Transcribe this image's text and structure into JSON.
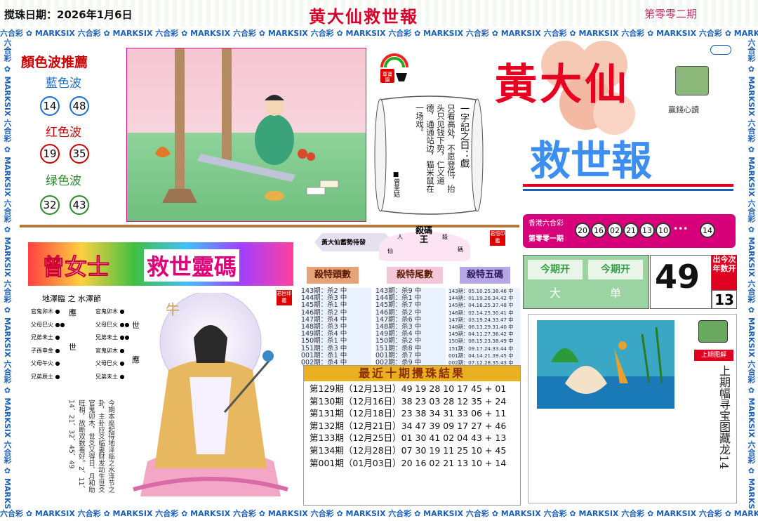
{
  "header": {
    "date": "搅珠日期：2026年1月6日",
    "title": "黄大仙救世報",
    "issue": "第零零二期"
  },
  "border_text": "六合彩 ✿ MARKSIX 六合彩 ✿ MARKSIX 六合彩 ✿ MARKSIX 六合彩 ✿ MARKSIX 六合彩 ✿ MARKSIX 六合彩 ✿ MARKSIX 六合彩 ✿ MARKSIX 六合彩 ✿ MARKSIX 六合彩 ✿ MARKSIX 六合彩 ✿ MARKSIX",
  "waves": {
    "title": "顏色波推薦",
    "blue": "藍色波",
    "blue_nums": [
      "14",
      "48"
    ],
    "red": "红色波",
    "red_nums": [
      "19",
      "35"
    ],
    "green": "绿色波",
    "green_nums": [
      "32",
      "43"
    ]
  },
  "poem": {
    "title": "一字記之曰：戲",
    "text": "只看高处，不愿登低，抬头只见钱下势，仁义道德，通通站边，猫米鼠在一场戏。",
    "sign": "■曾圣姑",
    "stamp": "尊寶園"
  },
  "logo": {
    "line1": "黃大仙",
    "line2": "救世報",
    "badge": "贏錢心讀"
  },
  "hk": {
    "label": "香港六合彩",
    "issue": "第零零一期",
    "nums": [
      "20",
      "16",
      "02",
      "21",
      "13",
      "10"
    ],
    "special": "14",
    "dots": "•••"
  },
  "now": {
    "h1": "今期开",
    "h2": "今期开",
    "v1": "大",
    "v2": "单",
    "big": "49",
    "small": "13",
    "side": "出今次年数开"
  },
  "spirit": {
    "title1": "曾女士",
    "title2": "救世靈碼",
    "subtitle": "地澤臨 之 水澤節",
    "ox": "牛",
    "seal": "君回印鑑",
    "left": [
      "官鬼卯木 ●",
      "父母巳火 ●●",
      "兄弟未土 ●",
      "子孫申金 ●",
      "父母午火 ●",
      "兄弟辰土 ●"
    ],
    "right": [
      "官鬼卯木 ●",
      "父母巳火 ●●",
      "兄弟未土 ●●",
      "官鬼卯木 ●",
      "父母巳火 ●",
      "兄弟未土 ●"
    ],
    "mark_left": [
      "應",
      "世"
    ],
    "mark_right": [
      "世",
      "應"
    ],
    "text": "今期本座起得地泽临之水泽节之卦，主卦应爻临妻财发动生世爻官鬼卯木，世爻又得日、月和助旺相，故断双数看好。2、11、14、21、32、45、49"
  },
  "banner": {
    "left": "黃大仙蓄勢待發",
    "kill": "殺碼王",
    "p1": "人",
    "p2": "殺",
    "p3": "仙",
    "p4": "碼",
    "seal": "君悟印鑑"
  },
  "kills": {
    "head": "殺特頭數",
    "tail": "殺特尾數",
    "five": "殺特五碼",
    "head_rows": [
      "143期：杀2 中",
      "144期：杀3 中",
      "145期：杀1 中",
      "146期：杀2 中",
      "147期：杀4 中",
      "148期：杀3 中",
      "149期：杀4 中",
      "150期：杀1 中",
      "151期：杀3 中",
      "001期：杀1 中",
      "002期：杀4 中"
    ],
    "tail_rows": [
      "143期：杀9 中",
      "144期：杀1 中",
      "145期：杀7 中",
      "146期：杀2 中",
      "147期：杀6 中",
      "148期：杀3 中",
      "149期：杀4 中",
      "150期：杀2 中",
      "151期：杀8 中",
      "001期：杀7 中",
      "002期：杀9 中"
    ],
    "five_rows": [
      "143期：05.10.25.38.46 中",
      "144期：01.19.26.34.42 中",
      "145期：04.16.25.37.48 中",
      "146期：02.14.25.30.41 中",
      "147期：03.19.24.33.47 中",
      "148期：06.13.29.31.40 中",
      "149期：04.11.27.36.42 中",
      "150期：08.15.23.38.49 中",
      "151期：09.17.24.33.44 中",
      "001期：04.14.21.39.45 中",
      "002期：07.12.28.35.43 中"
    ]
  },
  "results": {
    "title": "最近十期攪珠結果",
    "rows": [
      "第129期（12月13日）49 19 28 10 17 45 + 01",
      "第130期（12月16日）38 23 03 28 12 35 + 24",
      "第131期（12月18日）23 38 34 31 33 06 + 11",
      "第132期（12月21日）34 47 39 09 17 27 + 46",
      "第133期（12月25日）01 30 41 02 04 43 + 13",
      "第134期（12月28日）07 30 19 11 25 10 + 45",
      "第001期（01月03日）20 16 02 21 13 10 + 14"
    ]
  },
  "last": {
    "badge": "上期图解",
    "text": "上期幅寻宝图藏龙14"
  },
  "colors": {
    "red": "#e00020",
    "blue": "#1a5fb8",
    "green": "#2a8a2a",
    "magenta": "#d8007a",
    "gold": "#e9b01f"
  }
}
